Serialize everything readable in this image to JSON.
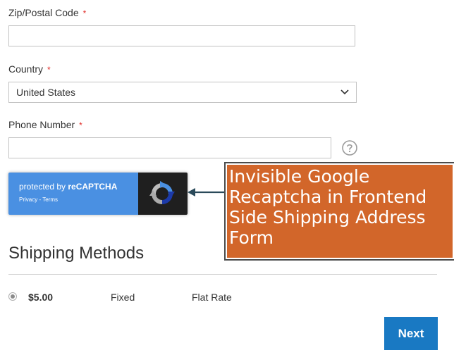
{
  "form": {
    "zip": {
      "label": "Zip/Postal Code",
      "required": "*",
      "value": ""
    },
    "country": {
      "label": "Country",
      "required": "*",
      "value": "United States"
    },
    "phone": {
      "label": "Phone Number",
      "required": "*",
      "value": ""
    }
  },
  "recaptcha": {
    "protected_by": "protected by ",
    "brand": "reCAPTCHA",
    "privacy": "Privacy",
    "separator": " - ",
    "terms": "Terms"
  },
  "callout": {
    "text": "Invisible Google\nRecaptcha in Frontend\nSide Shipping Address\nForm"
  },
  "shipping": {
    "title": "Shipping Methods",
    "methods": [
      {
        "price": "$5.00",
        "carrier": "Fixed",
        "method": "Flat Rate",
        "selected": true
      }
    ]
  },
  "actions": {
    "next_label": "Next"
  },
  "colors": {
    "accent": "#1979c3",
    "required": "#e02b27",
    "recaptcha_blue": "#4a90e2",
    "callout_orange": "#d2662a"
  },
  "icons": [
    "chevron-down-icon",
    "help-icon",
    "recaptcha-logo-icon",
    "arrow-left-icon",
    "radio-selected-icon"
  ]
}
